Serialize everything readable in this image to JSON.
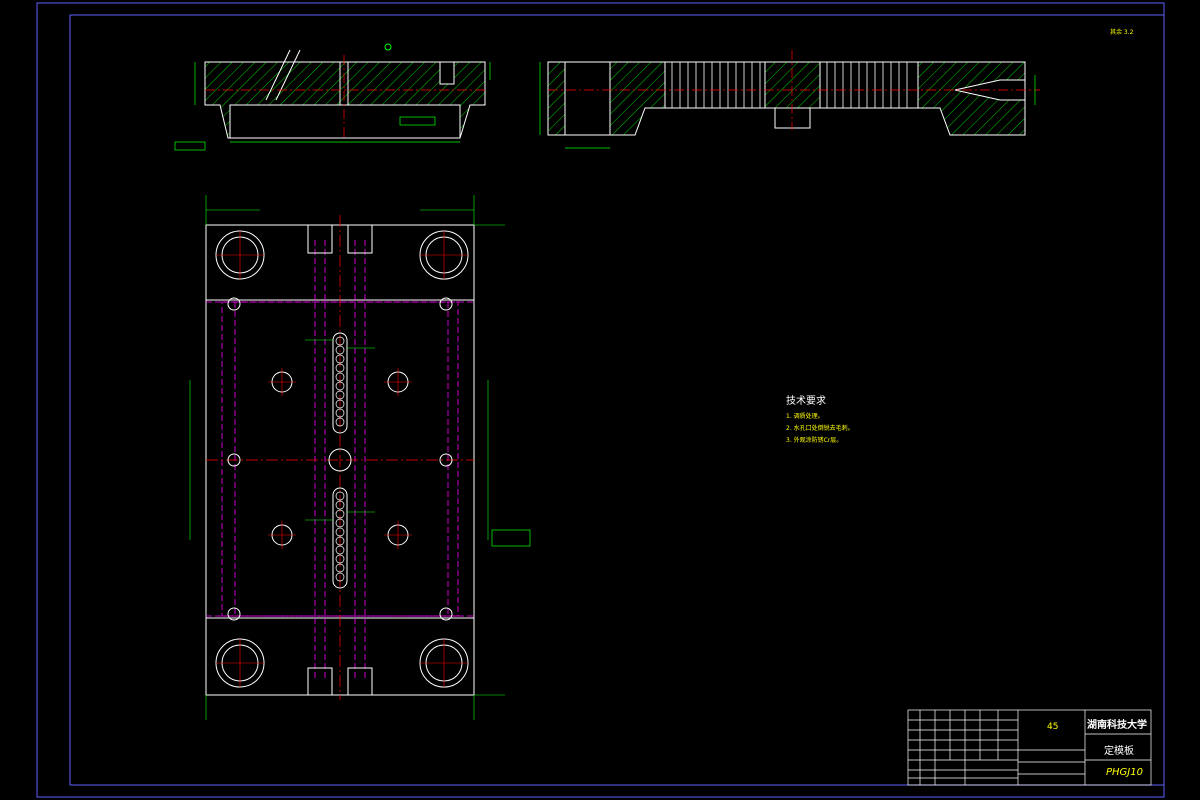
{
  "technical_requirements": {
    "title": "技术要求",
    "items": [
      "1. 调质处理。",
      "2. 水孔口处倒锐去毛刺。",
      "3. 外观涂防锈Cr层。"
    ]
  },
  "title_block": {
    "school": "湖南科技大学",
    "part_name": "定模板",
    "drawing_code": "PHGJ10",
    "material": "45"
  },
  "roughness_note": "其余 3.2",
  "colors": {
    "background": "#000000",
    "outline": "#ffffff",
    "hatch": "#00ff00",
    "dimension": "#00ff00",
    "centerline": "#ff0000",
    "hidden": "#ff00ff",
    "text": "#ffff00",
    "frame": "#0000ff"
  }
}
